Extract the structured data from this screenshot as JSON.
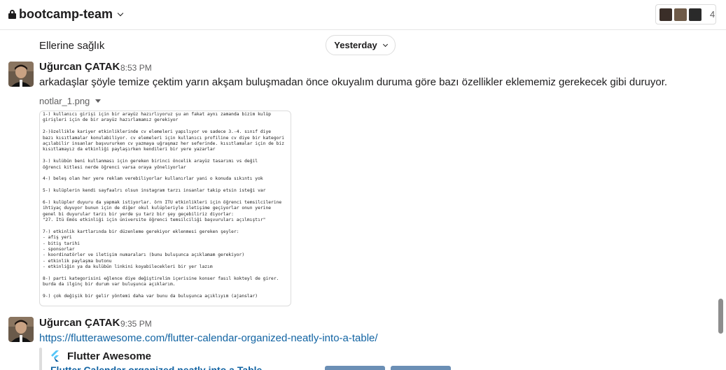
{
  "header": {
    "channel_name": "bootcamp-team",
    "member_count": "4"
  },
  "messages": {
    "previous_text": "Ellerine sağlık",
    "date_divider": "Yesterday",
    "msg1": {
      "sender": "Uğurcan ÇATAK",
      "time": "8:53 PM",
      "text": "arkadaşlar şöyle temize çektim yarın akşam buluşmadan önce okuyalım duruma göre bazı özellikler eklememiz gerekecek gibi duruyor.",
      "file_name": "notlar_1.png",
      "file_lines": [
        "1-) kullanıcı girişi için bir arayüz hazırlıyoruz şu an fakat aynı zamanda bizim kulüp",
        "girişleri için de bir arayüz hazırlamamız gerekiyor",
        "",
        "2-)özellikle kariyer etkinliklerinde cv elemeleri yapılıyor ve sadece 3.-4. sınıf diye",
        "bazı kısıtlamalar konulabiliyor. cv elemeleri için kullanıcı profiline cv diye bir kategori",
        "açılabilir insanlar başvururken cv yazmaya uğraşmaz her seferinde. kısıtlamalar için de biz",
        "kısıtlamayız da etkinliği paylaşırken kendileri bir yere yazarlar",
        "",
        "3-) kulübün beni kullanması için gereken birinci öncelik arayüz tasarımı vs değil",
        "öğrenci kitlesi nerde öğrenci varsa oraya yöneliyorlar",
        "",
        "4-) beleş olan her yere reklam verebiliyorlar kullanırlar yani o konuda sıkıntı yok",
        "",
        "5-) kulüplerin kendi sayfaalrı olsun instagram tarzı insanlar takip etsin isteği var",
        "",
        "6-) kulüpler duyuru da yapmak istiyorlar. örn İTÜ etkinlikleri için öğrenci temsilcilerine",
        "ihtiyaç duyuyor bunun için de diğer okul kulüpleriyle iletişime geçiyorlar onun yerine",
        "genel bi duyurular tarzı bir yerde şu tarz bir şey geçebiliriz diyorlar:",
        "\"27. İtü Emös etkinliği için üniversite öğrenci temsilciliği başvuruları açılmıştır\"",
        "",
        "7-) etkinlik kartlarında bir düzenleme gerekiyor eklenmesi gereken şeyler:",
        "- afiş yeri",
        "- bitiş tarihi",
        "- sponsorlar",
        "- koordinatörler ve iletişim numaraları (bunu buluşunca açıklamam gerekiyor)",
        "- etkinlik paylaşma butonu",
        "- etkinliğin ya da kulübün linkini koyabilecekleri bir yer lazım",
        "",
        "8-) parti kategorisini eğlence diye değiştirelim içerisine konser fasıl kokteyl de girer.",
        "burda da ilginç bir durum var buluşunca açıklarım.",
        "",
        "9-) çok değişik bir gelir yöntemi daha var bunu da buluşunca açıklıyım (ajanslar)"
      ]
    },
    "msg2": {
      "sender": "Uğurcan ÇATAK",
      "time": "9:35 PM",
      "link": "https://flutterawesome.com/flutter-calendar-organized-neatly-into-a-table/",
      "unfurl_site": "Flutter Awesome",
      "unfurl_title": "Flutter Calendar organized neatly into a Table"
    }
  },
  "colors": {
    "link": "#1264a3",
    "text": "#1d1c1d",
    "muted": "#616061"
  }
}
